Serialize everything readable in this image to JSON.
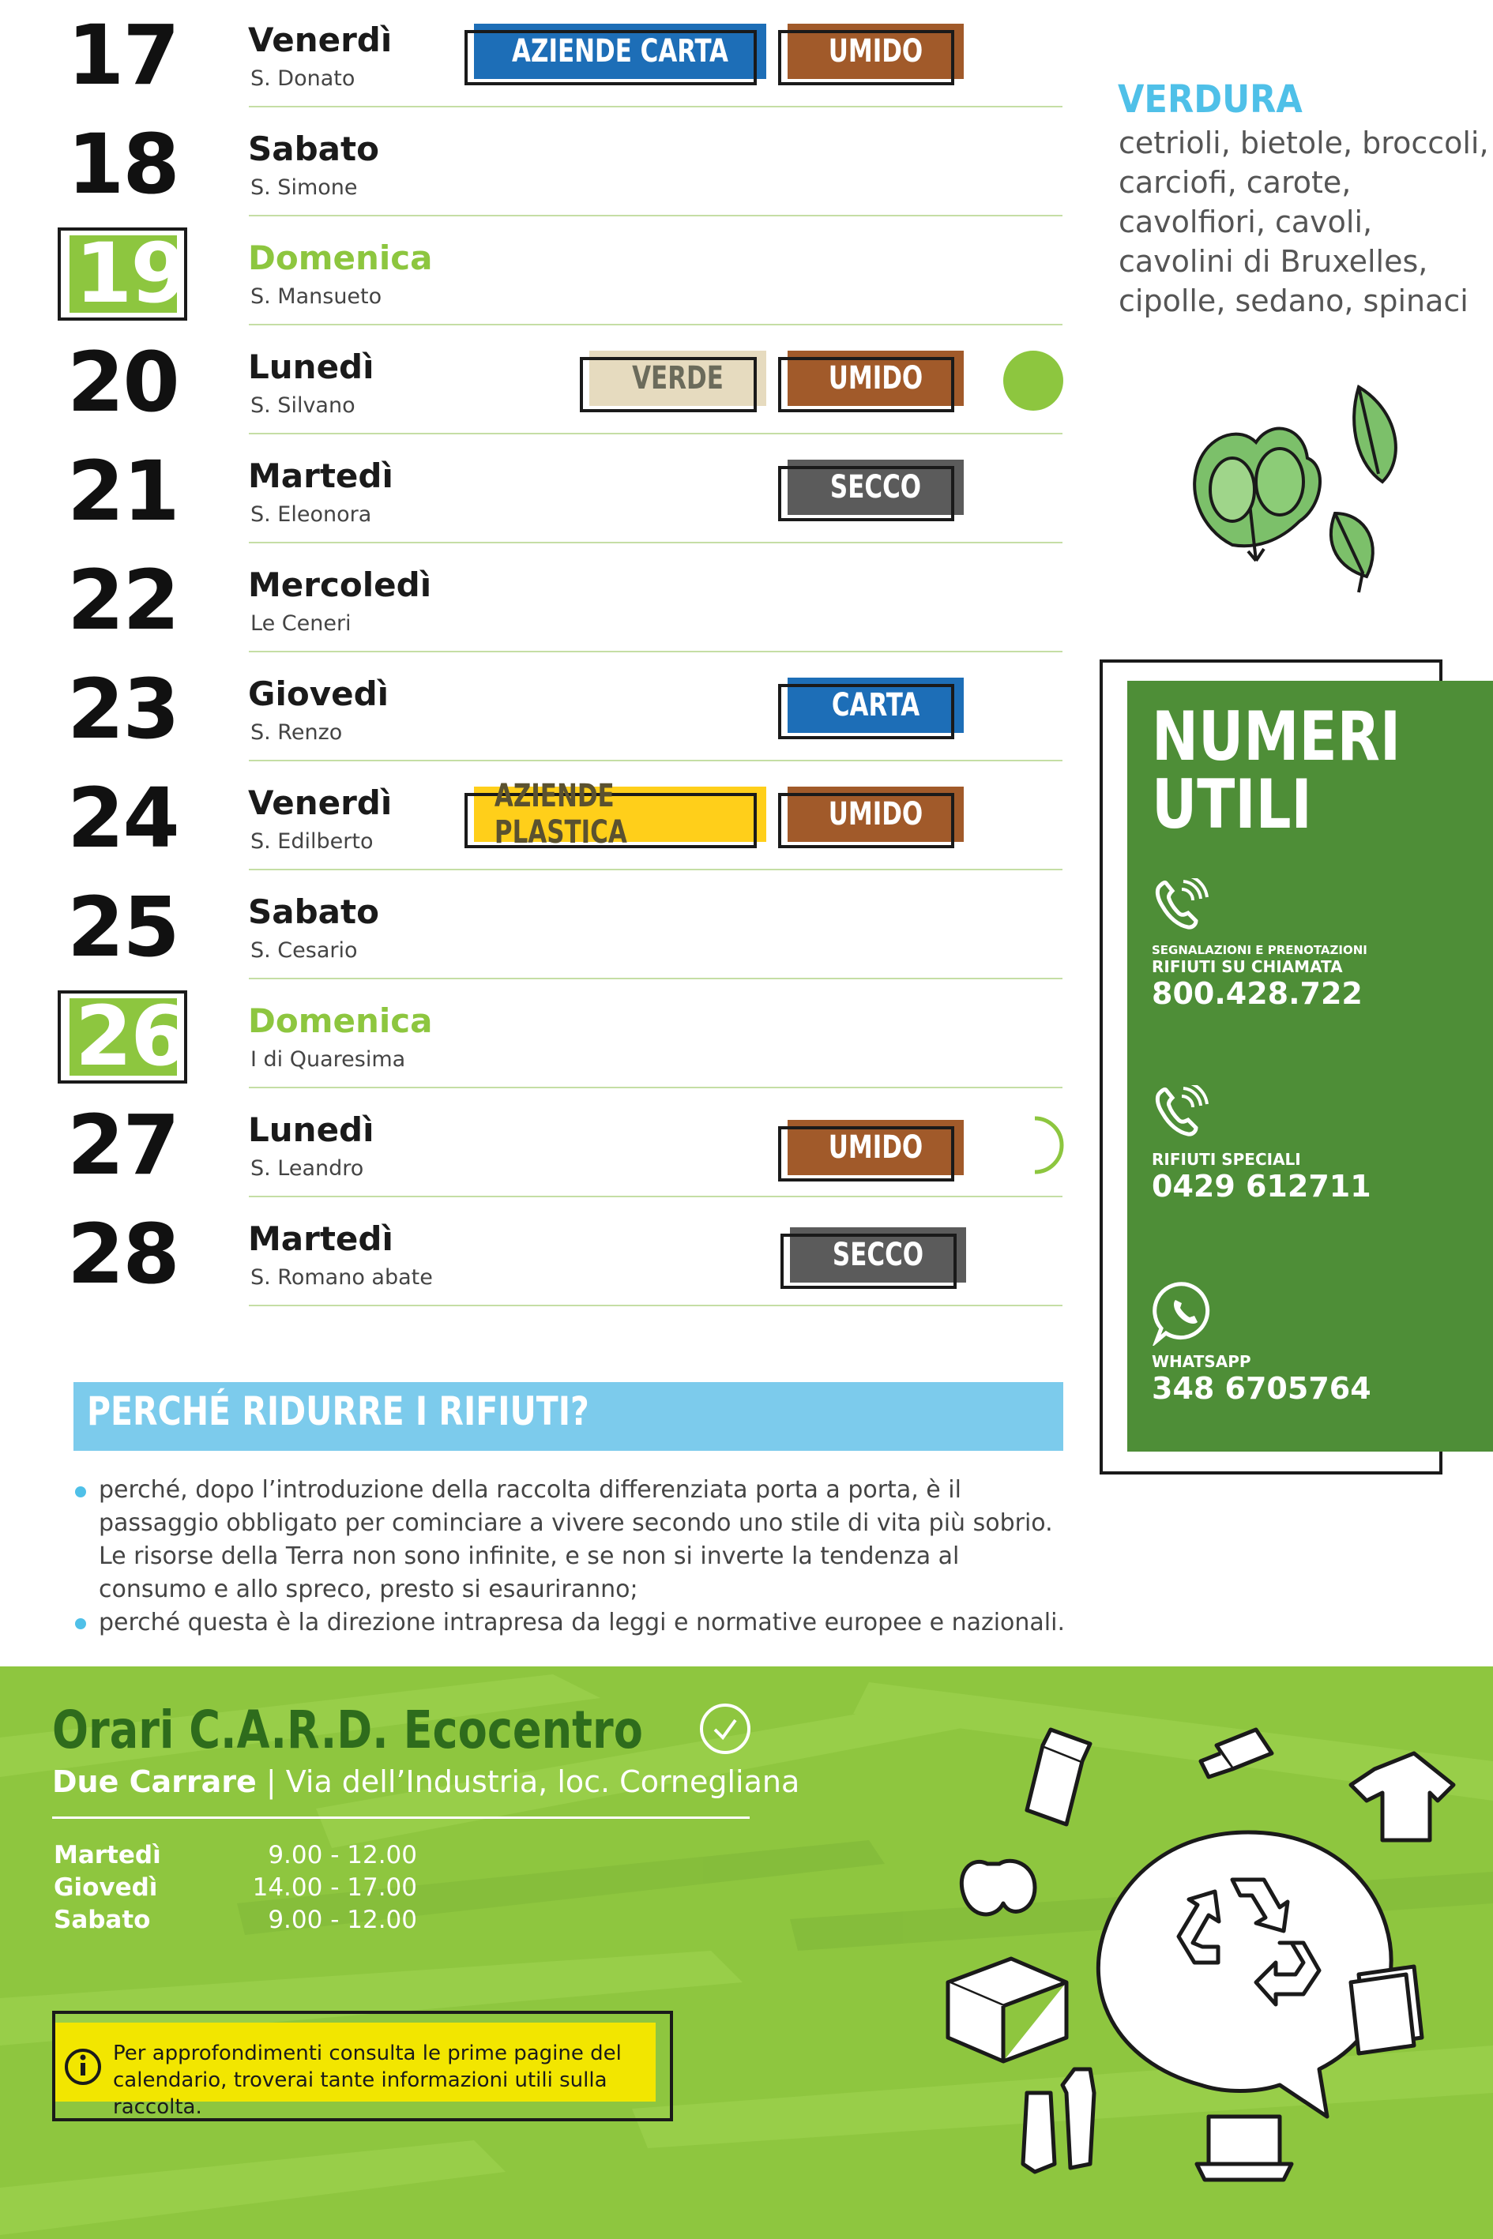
{
  "calendar": {
    "rows": [
      {
        "day": "17",
        "name": "Venerdì",
        "saint": "S. Donato"
      },
      {
        "day": "18",
        "name": "Sabato",
        "saint": "S. Simone"
      },
      {
        "day": "19",
        "name": "Domenica",
        "saint": "S. Mansueto"
      },
      {
        "day": "20",
        "name": "Lunedì",
        "saint": "S. Silvano"
      },
      {
        "day": "21",
        "name": "Martedì",
        "saint": "S. Eleonora"
      },
      {
        "day": "22",
        "name": "Mercoledì",
        "saint": "Le Ceneri"
      },
      {
        "day": "23",
        "name": "Giovedì",
        "saint": "S. Renzo"
      },
      {
        "day": "24",
        "name": "Venerdì",
        "saint": "S. Edilberto"
      },
      {
        "day": "25",
        "name": "Sabato",
        "saint": "S. Cesario"
      },
      {
        "day": "26",
        "name": "Domenica",
        "saint": "I di Quaresima"
      },
      {
        "day": "27",
        "name": "Lunedì",
        "saint": "S. Leandro"
      },
      {
        "day": "28",
        "name": "Martedì",
        "saint": "S. Romano abate"
      }
    ],
    "tags": {
      "aziende_carta": "AZIENDE CARTA",
      "umido": "UMIDO",
      "verde": "VERDE",
      "secco": "SECCO",
      "carta": "CARTA",
      "aziende_plastica": "AZIENDE PLASTICA"
    }
  },
  "verdura": {
    "title": "VERDURA",
    "text": "cetrioli, bietole, broccoli, carciofi, carote, cavolfiori, cavoli, cavolini di Bruxelles, cipolle, sedano, spinaci"
  },
  "numeri_utili": {
    "title_1": "NUMERI",
    "title_2": "UTILI",
    "entries": [
      {
        "small": "SEGNALAZIONI E PRENOTAZIONI",
        "label": "RIFIUTI SU CHIAMATA",
        "number": "800.428.722",
        "icon": "phone-icon"
      },
      {
        "label": "RIFIUTI SPECIALI",
        "number": "0429 612711",
        "icon": "phone-icon"
      },
      {
        "label": "WHATSAPP",
        "number": "348 6705764",
        "icon": "whatsapp-icon"
      }
    ]
  },
  "perche": {
    "title": "PERCHÉ RIDURRE I RIFIUTI?",
    "items": [
      "perché, dopo l’introduzione della raccolta differenziata porta a porta, è il passaggio obbligato per cominciare a vivere secondo uno stile di vita più sobrio. Le risorse della Terra non sono infinite, e se non si inverte la tendenza al consumo e allo spreco, presto si esauriranno;",
      "perché questa è la direzione intrapresa da leggi e normative europee e nazionali."
    ]
  },
  "orari": {
    "title": "Orari C.A.R.D. Ecocentro",
    "location_bold": "Due Carrare",
    "location_rest": " | Via dell’Industria, loc. Cornegliana",
    "schedule": [
      {
        "day": "Martedì",
        "time": "9.00 - 12.00"
      },
      {
        "day": "Giovedì",
        "time": "14.00 - 17.00"
      },
      {
        "day": "Sabato",
        "time": "9.00 - 12.00"
      }
    ]
  },
  "info": {
    "text_1": "Per approfondimenti consulta le prime pagine del",
    "text_2": "calendario, troverai tante informazioni utili sulla raccolta."
  },
  "colors": {
    "green_accent": "#8dc63f",
    "dark_green": "#4e8e37",
    "blue_carta": "#1d6eb7",
    "brown_umido": "#a15a2a",
    "grey_secco": "#5b5b5b",
    "sky": "#7ccbec"
  }
}
